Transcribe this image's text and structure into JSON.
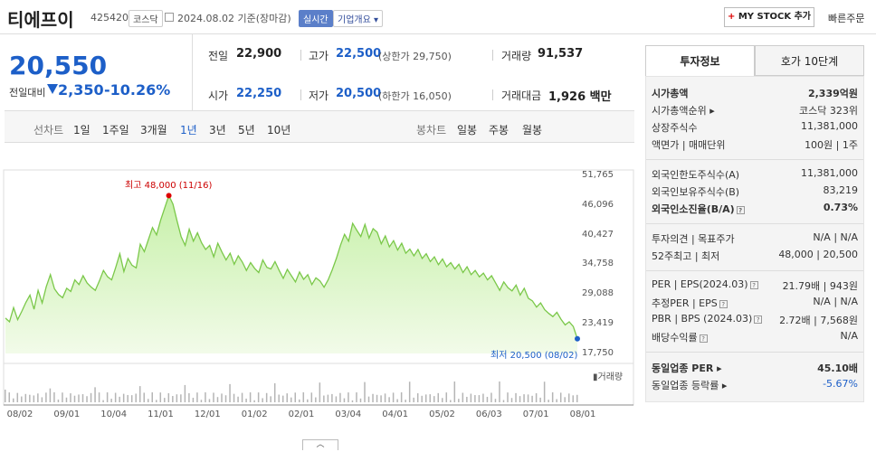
{
  "header": {
    "company_name": "티에프이",
    "code": "425420",
    "market": "코스닥",
    "as_of": "2024.08.02  기준(장마감)",
    "realtime_label": "실시간",
    "overview_label": "기업개요 ▾",
    "mystock_label": "MY STOCK 추가",
    "mystock_plus": "+",
    "quick_order_label": "빠른주문"
  },
  "price": {
    "current": "20,550",
    "change_label": "전일대비",
    "change": "2,350",
    "change_pct": "-10.26%",
    "prev_close_label": "전일",
    "prev_close": "22,900",
    "high_label": "고가",
    "high": "22,500",
    "upper_limit": "(상한가 29,750)",
    "volume_label": "거래량",
    "volume": "91,537",
    "open_label": "시가",
    "open": "22,250",
    "low_label": "저가",
    "low": "20,500",
    "lower_limit": "(하한가 16,050)",
    "value_label": "거래대금",
    "value": "1,926 백만"
  },
  "tabs": {
    "line_label": "선차트",
    "periods": [
      "1일",
      "1주일",
      "3개월",
      "1년",
      "3년",
      "5년",
      "10년"
    ],
    "active_period": "1년",
    "candle_label": "봉차트",
    "candles": [
      "일봉",
      "주봉",
      "월봉"
    ]
  },
  "chart_data": {
    "type": "area",
    "y_ticks": [
      "51,765",
      "46,096",
      "40,427",
      "34,758",
      "29,088",
      "23,419",
      "17,750"
    ],
    "ylim": [
      17750,
      51765
    ],
    "x_ticks": [
      "08/02",
      "09/01",
      "10/04",
      "11/01",
      "12/01",
      "01/02",
      "02/01",
      "03/04",
      "04/01",
      "05/02",
      "06/03",
      "07/01",
      "08/01"
    ],
    "high_annotation": "최고 48,000 (11/16)",
    "low_annotation": "최저 20,500 (08/02)",
    "volume_legend": "▮거래량",
    "series": [
      {
        "values": [
          24500,
          23800,
          26500,
          24200,
          25800,
          27500,
          28900,
          26200,
          29800,
          27400,
          30500,
          32800,
          30100,
          29000,
          28400,
          30200,
          29600,
          31800,
          30900,
          32600,
          31200,
          30400,
          29800,
          31600,
          33600,
          32400,
          31800,
          34200,
          36800,
          33400,
          35900,
          34600,
          34100,
          38600,
          37200,
          39500,
          41800,
          40400,
          43200,
          45600,
          47900,
          46300,
          43100,
          40100,
          38400,
          41500,
          39200,
          40800,
          38900,
          37600,
          38400,
          36200,
          38800,
          37100,
          35600,
          36900,
          34800,
          36400,
          35200,
          33600,
          35100,
          34000,
          33200,
          35600,
          34200,
          33900,
          35300,
          33600,
          32100,
          33800,
          32600,
          31400,
          33300,
          31900,
          32800,
          30900,
          32200,
          31600,
          30400,
          31800,
          33700,
          35900,
          38400,
          40500,
          39200,
          42600,
          41300,
          40100,
          42400,
          39800,
          41600,
          40900,
          38700,
          40200,
          38100,
          39300,
          37500,
          38800,
          36900,
          37700,
          36400,
          37600,
          35900,
          36800,
          35300,
          36200,
          34700,
          35800,
          34300,
          35100,
          33900,
          34800,
          33200,
          34300,
          32800,
          33600,
          32400,
          33100,
          31800,
          32600,
          31200,
          29800,
          31400,
          30300,
          29700,
          30800,
          28900,
          30200,
          28300,
          27800,
          26600,
          27400,
          26100,
          25400,
          24800,
          25600,
          24300,
          23200,
          23800,
          22900,
          20550
        ]
      }
    ]
  },
  "side": {
    "tab_info": "투자정보",
    "tab_order": "호가 10단계",
    "rows1": [
      {
        "label": "시가총액",
        "value": "2,339억원"
      },
      {
        "label": "시가총액순위 ▸",
        "value": "코스닥 323위"
      },
      {
        "label": "상장주식수",
        "value": "11,381,000"
      },
      {
        "label": "액면가 | 매매단위",
        "value": "100원 | 1주"
      }
    ],
    "rows2": [
      {
        "label": "외국인한도주식수(A)",
        "value": "11,381,000"
      },
      {
        "label": "외국인보유주식수(B)",
        "value": "83,219"
      },
      {
        "label": "외국인소진율(B/A)",
        "value": "0.73%"
      }
    ],
    "rows3": [
      {
        "label": "투자의견 | 목표주가",
        "value": "N/A | N/A"
      },
      {
        "label": "52주최고 | 최저",
        "value": "48,000 | 20,500"
      }
    ],
    "rows4": [
      {
        "label": "PER | EPS(2024.03)",
        "value": "21.79배 | 943원"
      },
      {
        "label": "추정PER | EPS",
        "value": "N/A | N/A"
      },
      {
        "label": "PBR | BPS (2024.03)",
        "value": "2.72배 | 7,568원"
      },
      {
        "label": "배당수익률",
        "value": "N/A"
      }
    ],
    "rows5": [
      {
        "label": "동일업종 PER ▸",
        "value": "45.10배"
      },
      {
        "label": "동일업종 등락률 ▸",
        "value": "-5.67%"
      }
    ],
    "help_icon": "?"
  },
  "collapse_label": "︿"
}
